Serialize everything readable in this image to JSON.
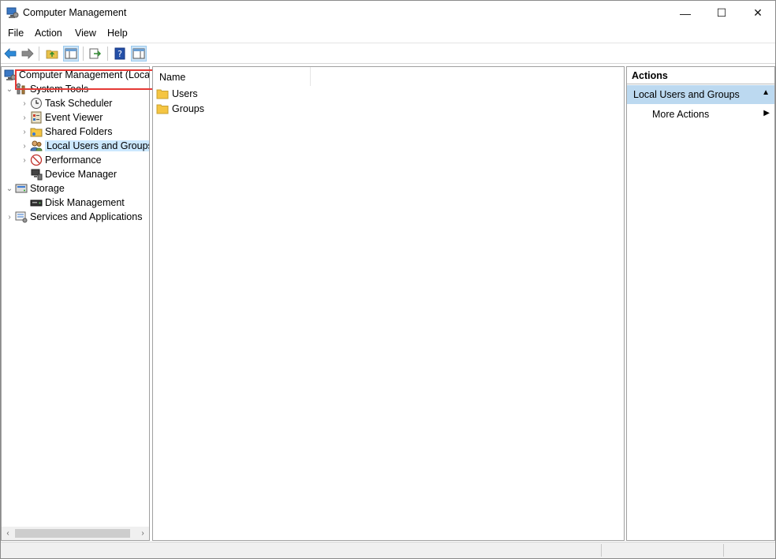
{
  "window": {
    "title": "Computer Management",
    "minimize_glyph": "—",
    "maximize_glyph": "☐",
    "close_glyph": "✕"
  },
  "menu": [
    "File",
    "Action",
    "View",
    "Help"
  ],
  "toolbar": {
    "buttons": [
      "back-icon",
      "forward-icon",
      "up-folder-icon",
      "show-hide-tree-icon",
      "export-list-icon",
      "help-icon",
      "show-hide-action-pane-icon"
    ]
  },
  "tree": {
    "root": "Computer Management (Local",
    "system_tools": "System Tools",
    "task_scheduler": "Task Scheduler",
    "event_viewer": "Event Viewer",
    "shared_folders": "Shared Folders",
    "local_users_groups": "Local Users and Groups",
    "performance": "Performance",
    "device_manager": "Device Manager",
    "storage": "Storage",
    "disk_management": "Disk Management",
    "services_apps": "Services and Applications"
  },
  "list": {
    "column_name": "Name",
    "items": [
      "Users",
      "Groups"
    ]
  },
  "actions": {
    "header": "Actions",
    "section": "Local Users and Groups",
    "more_actions": "More Actions"
  },
  "colors": {
    "highlight_border": "#e53935",
    "action_section_bg": "#bcd9f0",
    "folder_yellow": "#f5c542"
  }
}
